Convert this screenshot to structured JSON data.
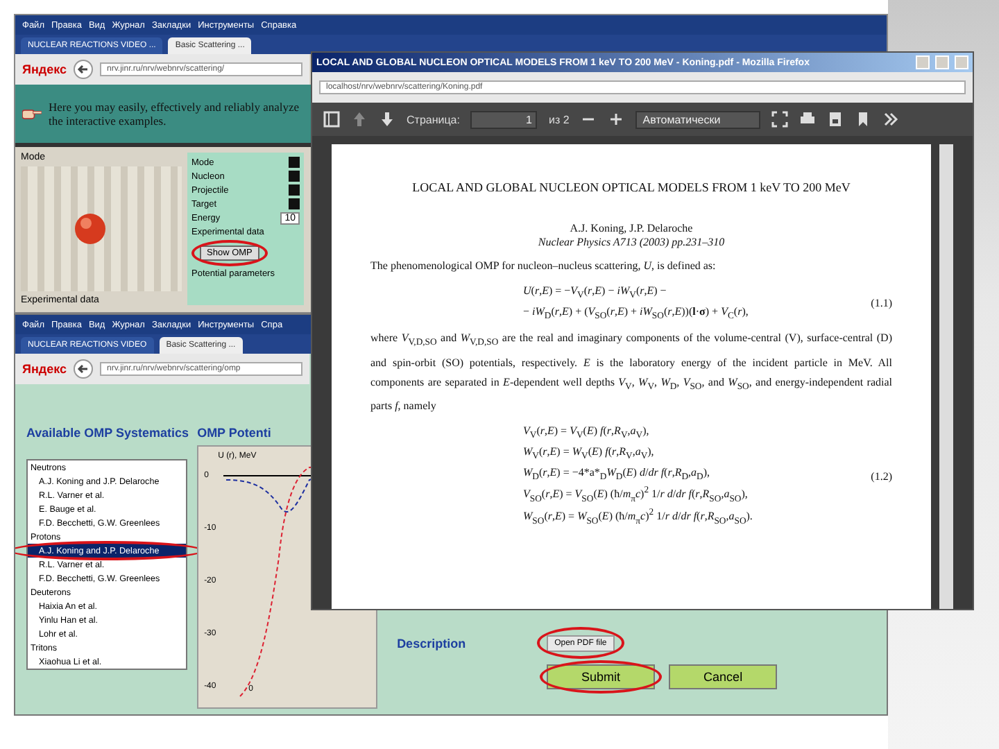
{
  "scatter_window": {
    "menu": [
      "Файл",
      "Правка",
      "Вид",
      "Журнал",
      "Закладки",
      "Инструменты",
      "Справка"
    ],
    "tabs": [
      {
        "label": "NUCLEAR REACTIONS VIDEO ...",
        "selected": false
      },
      {
        "label": "Basic Scattering ...",
        "selected": true
      }
    ],
    "search_logo": "Яндекс",
    "address": "nrv.jinr.ru/nrv/webnrv/scattering/",
    "banner": "Here you may easily, effectively and reliably analyze the interactive examples.",
    "image_label": "Mode",
    "controls": [
      {
        "label": "Mode"
      },
      {
        "label": "Nucleon"
      },
      {
        "label": "Projectile"
      },
      {
        "label": "Target"
      },
      {
        "label": "Energy",
        "value": "10"
      }
    ],
    "exp_label": "Experimental data",
    "show_button": "Show OMP",
    "params_label": "Potential parameters",
    "exp_data_label": "Experimental data"
  },
  "omp_window": {
    "menu": [
      "Файл",
      "Правка",
      "Вид",
      "Журнал",
      "Закладки",
      "Инструменты",
      "Спра"
    ],
    "tabs": [
      {
        "label": "NUCLEAR REACTIONS VIDEO",
        "selected": false
      },
      {
        "label": "Basic Scattering ...",
        "selected": true
      }
    ],
    "search_logo": "Яндекс",
    "address": "nrv.jinr.ru/nrv/webnrv/scattering/omp",
    "systematics_title": "Available OMP Systematics",
    "potential_title": "OMP Potenti",
    "systematics": [
      {
        "label": "Neutrons",
        "kind": "group",
        "selected": false
      },
      {
        "label": "A.J. Koning and J.P. Delaroche",
        "kind": "item",
        "selected": false
      },
      {
        "label": "R.L. Varner et al.",
        "kind": "item",
        "selected": false
      },
      {
        "label": "E. Bauge et al.",
        "kind": "item",
        "selected": false
      },
      {
        "label": "F.D. Becchetti, G.W. Greenlees",
        "kind": "item",
        "selected": false
      },
      {
        "label": "Protons",
        "kind": "group",
        "selected": false
      },
      {
        "label": "A.J. Koning and J.P. Delaroche",
        "kind": "item",
        "selected": true
      },
      {
        "label": "R.L. Varner et al.",
        "kind": "item",
        "selected": false
      },
      {
        "label": "F.D. Becchetti, G.W. Greenlees",
        "kind": "item",
        "selected": false
      },
      {
        "label": "Deuterons",
        "kind": "group",
        "selected": false
      },
      {
        "label": "Haixia An et al.",
        "kind": "item",
        "selected": false
      },
      {
        "label": "Yinlu Han et al.",
        "kind": "item",
        "selected": false
      },
      {
        "label": "Lohr et al.",
        "kind": "item",
        "selected": false
      },
      {
        "label": "Tritons",
        "kind": "group",
        "selected": false
      },
      {
        "label": "Xiaohua Li et al.",
        "kind": "item",
        "selected": false
      }
    ],
    "plot": {
      "y_title": "U (r), MeV",
      "y_labels": [
        "0",
        "-10",
        "-20",
        "-30",
        "-40"
      ],
      "x_label": "0"
    },
    "description_label": "Description",
    "file_button": "Open PDF file",
    "submit": "Submit",
    "cancel": "Cancel"
  },
  "pdf_window": {
    "title": "LOCAL AND GLOBAL NUCLEON OPTICAL MODELS FROM 1 keV TO 200 MeV - Koning.pdf - Mozilla Firefox",
    "address": "localhost/nrv/webnrv/scattering/Koning.pdf",
    "page_label": "Страница:",
    "page": "1",
    "page_count": "из 2",
    "zoom": "Автоматически",
    "doc": {
      "title": "LOCAL AND GLOBAL NUCLEON OPTICAL MODELS FROM 1 keV TO 200 MeV",
      "authors": "A.J. Koning, J.P. Delaroche",
      "journal": "Nuclear Physics A713 (2003) pp.231–310",
      "blocks": [
        {
          "kind": "para",
          "text": "The phenomenological OMP for nucleon–nucleus scattering, *U*, is defined as:"
        },
        {
          "kind": "eq",
          "lines": [
            "*U*(*r*,*E*) = −*V*$_{V}$(*r*,*E*) − *iW*$_{V}$(*r*,*E*) −",
            "− *iW*$_{D}$(*r*,*E*) + (*V*$_{SO}$(*r*,*E*) + *iW*$_{SO}$(*r*,*E*))(**l**·**σ**) + *V*$_{C}$(*r*),"
          ],
          "number": "(1.1)"
        },
        {
          "kind": "para",
          "text": "where *V*$_{V,D,SO}$ and *W*$_{V,D,SO}$ are the real and imaginary components of the volume-central (V), surface-central (D) and spin-orbit (SO) potentials, respectively. *E* is the laboratory energy of the incident particle in MeV. All components are separated in *E*-dependent well depths *V*$_{V}$, *W*$_{V}$, *W*$_{D}$, *V*$_{SO}$, and *W*$_{SO}$, and energy-independent radial parts *f*, namely"
        },
        {
          "kind": "eq",
          "lines": [
            "*V*$_{V}$(*r*,*E*) = *V*$_{V}$(*E*) *f*(*r*,*R*$_{V}$,*a*$_{V}$),",
            "*W*$_{V}$(*r*,*E*) = *W*$_{V}$(*E*) *f*(*r*,*R*$_{V}$,*a*$_{V}$),",
            "*W*$_{D}$(*r*,*E*) = −4*a*$_{D}$*W*$_{D}$(*E*) *d*/*dr* *f*(*r*,*R*$_{D}$,*a*$_{D}$),",
            "*V*$_{SO}$(*r*,*E*) = *V*$_{SO}$(*E*) (ħ/*m*$_{π}$*c*)$^{2}$ 1/*r* *d*/*dr* *f*(*r*,*R*$_{SO}$,*a*$_{SO}$),",
            "*W*$_{SO}$(*r*,*E*) = *W*$_{SO}$(*E*) (ħ/*m*$_{π}$*c*)$^{2}$ 1/*r* *d*/*dr* *f*(*r*,*R*$_{SO}$,*a*$_{SO}$)."
          ],
          "number": "(1.2)"
        }
      ]
    }
  }
}
